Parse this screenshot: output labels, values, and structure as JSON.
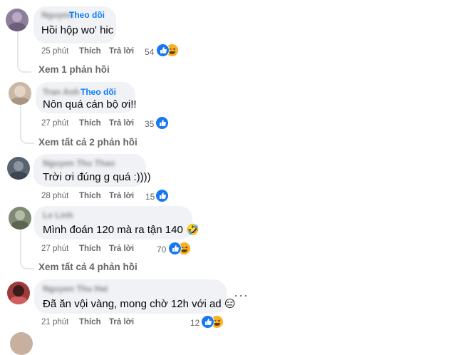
{
  "comments": [
    {
      "name": "Nguyen",
      "follow": "Theo dõi",
      "text": "Hồi hộp wo' hic",
      "time": "25 phút",
      "like": "Thích",
      "reply": "Trả lời",
      "reaction_count": "54",
      "reactions": [
        "like-icon",
        "haha-icon"
      ],
      "avatar_color": "#8e7f9a"
    },
    {
      "name": "Tran Anh",
      "follow": "Theo dõi",
      "text": "Nôn quá cán bộ ơi!!",
      "time": "27 phút",
      "like": "Thích",
      "reply": "Trả lời",
      "reaction_count": "35",
      "reactions": [
        "like-icon"
      ],
      "avatar_color": "#c9b8a6"
    },
    {
      "name": "Nguyen Thu Thao",
      "text": "Trời ơi đúng g quá :))))",
      "time": "28 phút",
      "like": "Thích",
      "reply": "Trả lời",
      "reaction_count": "15",
      "reactions": [
        "like-icon"
      ],
      "avatar_color": "#5a6470"
    },
    {
      "name": "Le Linh",
      "text": "Mình đoán 120 mà ra tận 140 🤣",
      "time": "27 phút",
      "like": "Thích",
      "reply": "Trả lời",
      "reaction_count": "70",
      "reactions": [
        "like-icon",
        "haha-icon"
      ],
      "avatar_color": "#7f8a74"
    },
    {
      "name": "Nguyen Thu Hai",
      "text": "Đã ăn vội vàng, mong chờ 12h với ad 😑",
      "time": "21 phút",
      "like": "Thích",
      "reply": "Trả lời",
      "reaction_count": "12",
      "reactions": [
        "like-icon",
        "haha-icon"
      ],
      "avatar_color": "#a03a3a"
    }
  ],
  "reply_links": {
    "c1": "Xem 1 phản hồi",
    "c2": "Xem tất cả 2 phản hồi",
    "c4": "Xem tất cả 4 phản hồi"
  },
  "more_options": "···",
  "colors": {
    "bubble": "#f0f2f5",
    "meta_text": "#65676b",
    "follow_link": "#0a7cff",
    "like_blue": "#1877f2",
    "haha_yellow": "#f7b125"
  }
}
